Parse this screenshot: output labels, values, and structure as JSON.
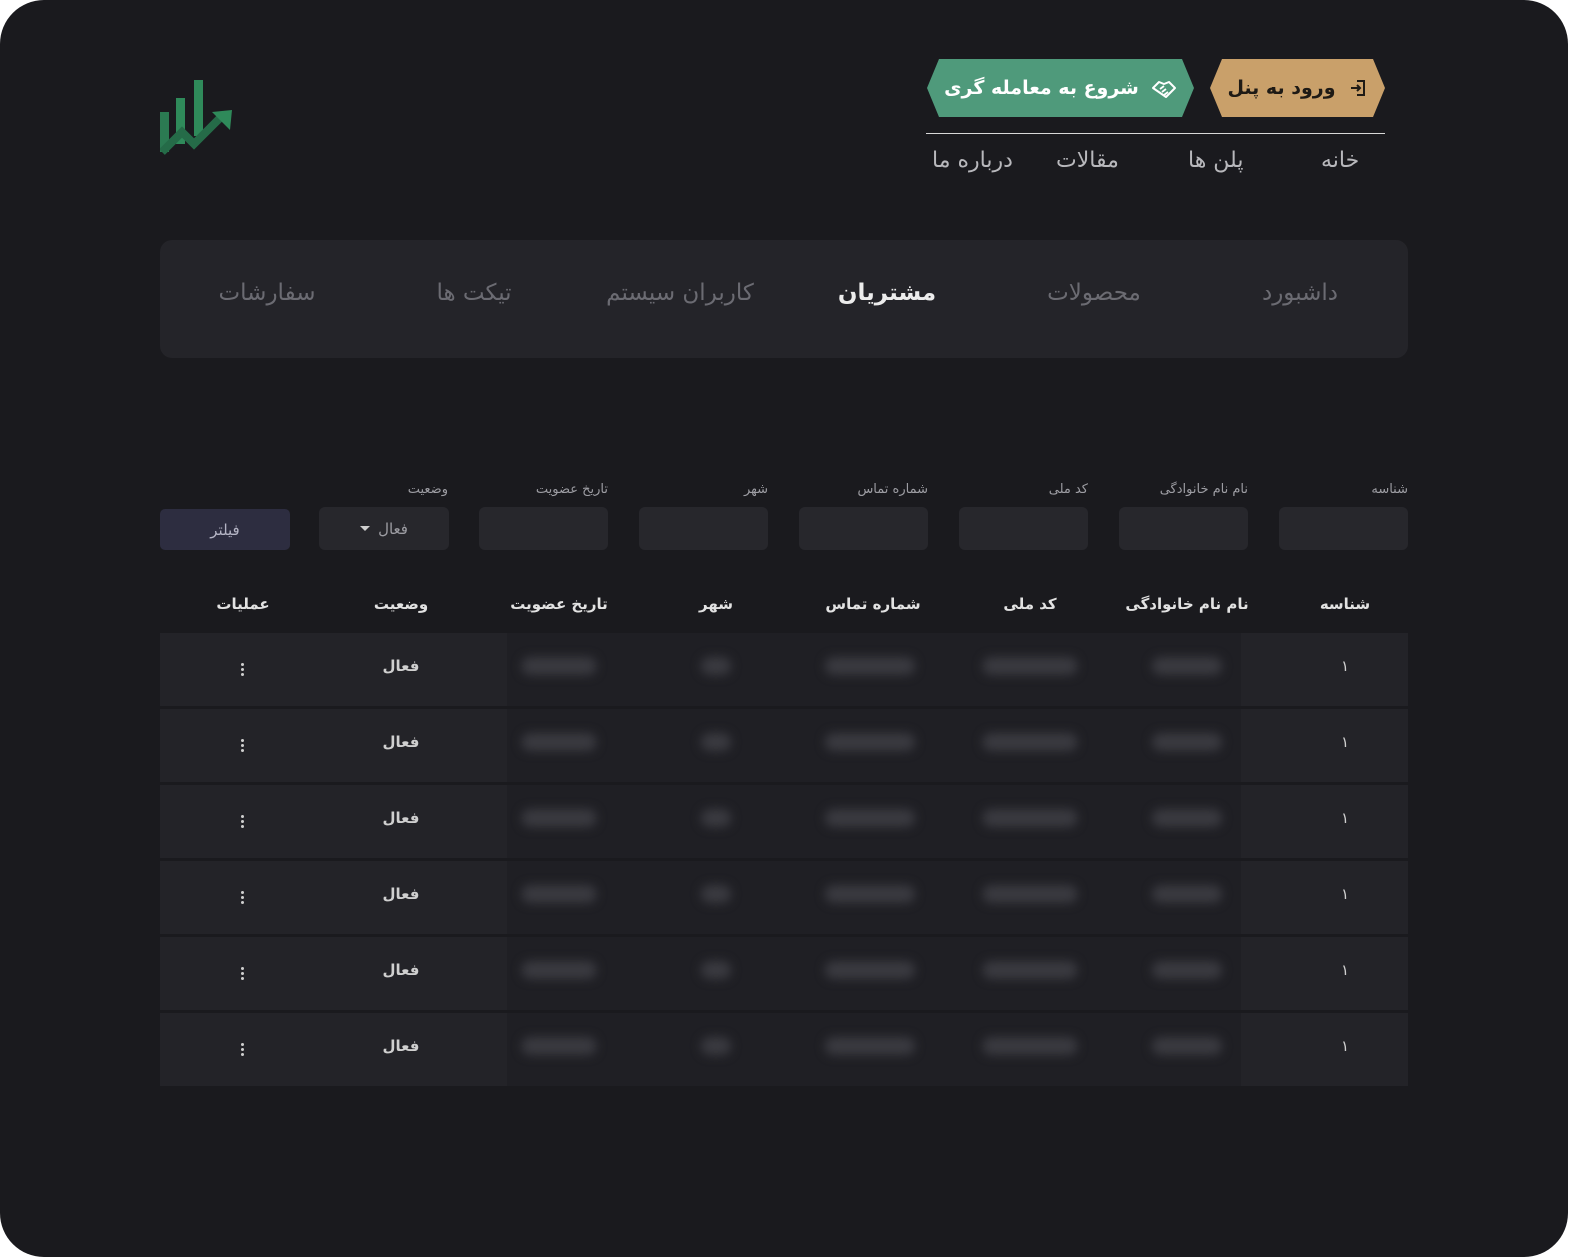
{
  "header": {
    "login_button": "ورود به پنل",
    "trade_button": "شروع به معامله گری",
    "nav": [
      "خانه",
      "پلن ها",
      "مقالات",
      "درباره ما"
    ]
  },
  "tabs": {
    "items": [
      "داشبورد",
      "محصولات",
      "مشتریان",
      "کاربران سیستم",
      "تیکت ها",
      "سفارشات"
    ],
    "active": "مشتریان"
  },
  "filters": {
    "labels": [
      "شناسه",
      "نام نام خانوادگی",
      "کد ملی",
      "شماره تماس",
      "شهر",
      "تاریخ عضویت",
      "وضعیت"
    ],
    "status_selected": "فعال",
    "button": "فیلتر"
  },
  "table": {
    "columns": [
      "شناسه",
      "نام نام خانوادگی",
      "کد ملی",
      "شماره تماس",
      "شهر",
      "تاریخ عضویت",
      "وضعیت",
      "عملیات"
    ],
    "rows": [
      {
        "id": "۱",
        "status": "فعال"
      },
      {
        "id": "۱",
        "status": "فعال"
      },
      {
        "id": "۱",
        "status": "فعال"
      },
      {
        "id": "۱",
        "status": "فعال"
      },
      {
        "id": "۱",
        "status": "فعال"
      },
      {
        "id": "۱",
        "status": "فعال"
      }
    ]
  },
  "colors": {
    "background": "#1a1a1e",
    "panel": "#242429",
    "login_accent": "#c9a06a",
    "trade_accent": "#4f9a7b",
    "logo_green": "#2f8a5a"
  }
}
